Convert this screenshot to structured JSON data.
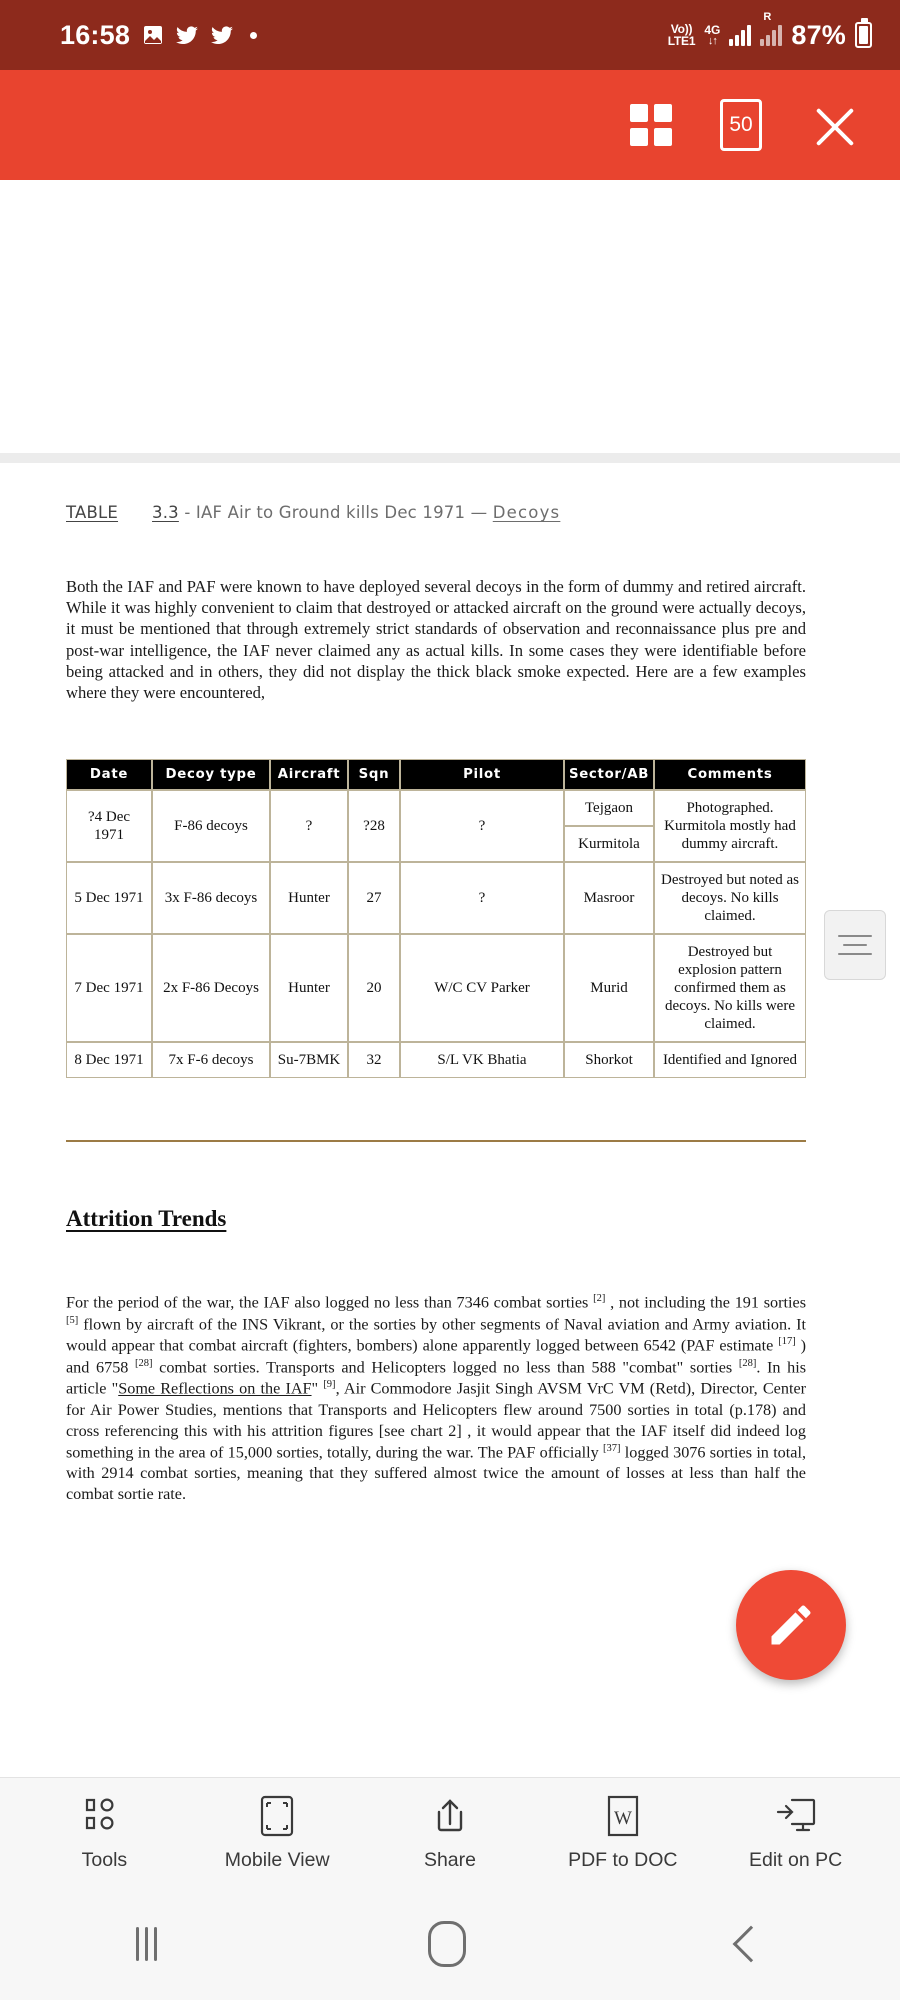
{
  "status_bar": {
    "clock": "16:58",
    "icons": [
      "photo-icon",
      "twitter-icon",
      "twitter-icon",
      "dot-icon"
    ],
    "volte_line1": "Vo))",
    "volte_line2": "LTE1",
    "network_type": "4G",
    "data_arrows": "↓↑",
    "sim2_label": "R",
    "battery_percent": "87%",
    "background_color": "#8d2a1c"
  },
  "app_bar": {
    "background_color": "#e8442f",
    "page_count": "50",
    "grid_label": "grid-view",
    "close_label": "close"
  },
  "document": {
    "caption": {
      "table_word": "TABLE",
      "number": "3.3",
      "dash_text": "- IAF  Air to Ground kills Dec 1971 — ",
      "decoys_word": "Decoys"
    },
    "intro_paragraph": "Both the IAF and PAF were known to have deployed several decoys in the form of dummy and retired aircraft. While it was highly convenient to claim that destroyed or attacked aircraft on the ground were actually decoys, it must be mentioned that through extremely strict standards of observation and reconnaissance plus pre and post-war intelligence, the IAF never claimed any as actual kills. In some cases they were identifiable before being attacked and in others, they did not display the thick black smoke expected.  Here are a few examples where they were encountered,",
    "table": {
      "columns": [
        "Date",
        "Decoy type",
        "Aircraft",
        "Sqn",
        "Pilot",
        "Sector/AB",
        "Comments"
      ],
      "rows": [
        {
          "date": "?4 Dec 1971",
          "decoy_type": "F-86 decoys",
          "aircraft": "?",
          "sqn": "?28",
          "pilot": "?",
          "sector": [
            "Tejgaon",
            "Kurmitola"
          ],
          "comments": "Photographed.  Kurmitola mostly had dummy aircraft."
        },
        {
          "date": "5 Dec 1971",
          "decoy_type": "3x F-86  decoys",
          "aircraft": "Hunter",
          "sqn": "27",
          "pilot": "?",
          "sector": [
            "Masroor"
          ],
          "comments": "Destroyed but noted as decoys. No kills claimed."
        },
        {
          "date": "7 Dec 1971",
          "decoy_type": "2x F-86  Decoys",
          "aircraft": "Hunter",
          "sqn": "20",
          "pilot": "W/C CV Parker",
          "sector": [
            "Murid"
          ],
          "comments": "Destroyed but explosion pattern confirmed them as decoys. No kills were claimed."
        },
        {
          "date": "8 Dec 1971",
          "decoy_type": "7x  F-6 decoys",
          "aircraft": "Su-7BMK",
          "sqn": "32",
          "pilot": "S/L VK Bhatia",
          "sector": [
            "Shorkot"
          ],
          "comments": "Identified and Ignored"
        }
      ]
    },
    "section_heading": "Attrition Trends",
    "attrition_paragraph": {
      "p1": " For the period of the war, the IAF also logged no less than 7346 combat sorties ",
      "r2": "[2]",
      "p2": " , not including the 191 sorties ",
      "r5": "[5]",
      "p3": " flown by aircraft of the INS Vikrant, or the sorties by other segments of Naval aviation and Army aviation. It would appear that combat aircraft (fighters, bombers) alone apparently logged between 6542 (PAF  estimate ",
      "r17": "[17]",
      "p4": " ) and  6758 ",
      "r28a": "[28]",
      "p5": " combat sorties. Transports and Helicopters logged no less than 588 \"combat\" sorties ",
      "r28b": "[28]",
      "p6": ".  In his article \"",
      "link": "Some Reflections on the IAF",
      "p7": "\" ",
      "r9": "[9]",
      "p8": ", Air Commodore Jasjit Singh AVSM VrC VM (Retd), Director, Center for Air Power Studies, mentions that Transports and Helicopters flew around 7500 sorties in total (p.178) and cross referencing this with his attrition figures [see chart 2] , it would appear that the IAF itself did indeed log something in the area of 15,000 sorties, totally, during the war.  The PAF officially ",
      "r37": "[37]",
      "p9": " logged 3076 sorties in total, with 2914 combat sorties, meaning that they suffered almost twice the amount of losses at less than half the combat sortie rate."
    }
  },
  "fab": {
    "name": "edit-pencil",
    "color": "#ef4a36"
  },
  "bottom_toolbar": {
    "items": [
      {
        "label": "Tools",
        "icon": "tools-icon"
      },
      {
        "label": "Mobile View",
        "icon": "mobile-view-icon"
      },
      {
        "label": "Share",
        "icon": "share-icon"
      },
      {
        "label": "PDF to DOC",
        "icon": "word-doc-icon"
      },
      {
        "label": "Edit on PC",
        "icon": "edit-on-pc-icon"
      }
    ]
  },
  "nav_bar": {
    "recent_label": "recent-apps",
    "home_label": "home",
    "back_label": "back"
  }
}
